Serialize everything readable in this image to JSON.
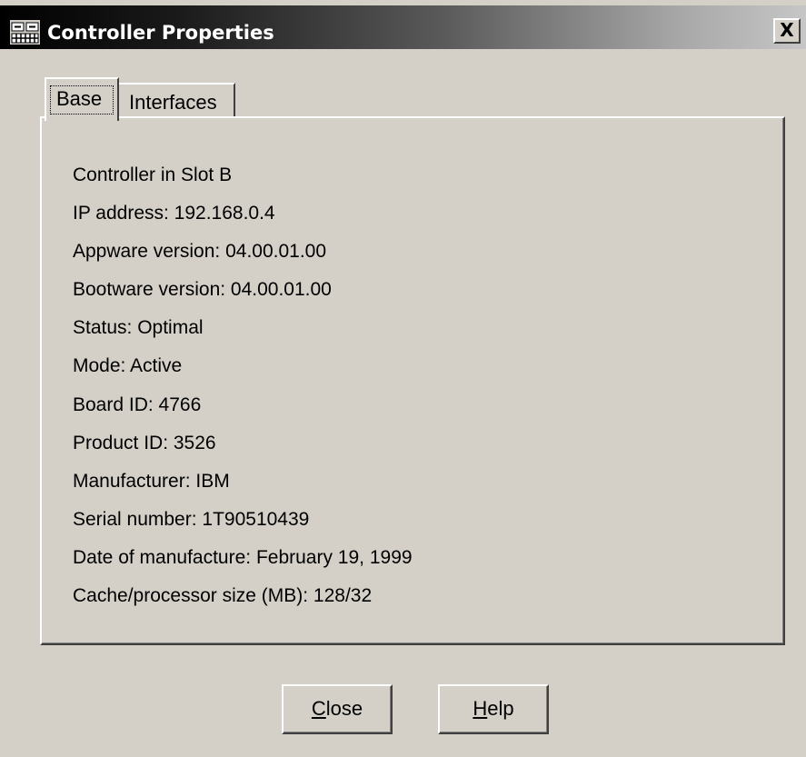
{
  "window": {
    "title": "Controller Properties",
    "close_glyph": "X",
    "icon": "controller-grid-icon"
  },
  "tabs": [
    {
      "label": "Base",
      "selected": true
    },
    {
      "label": "Interfaces",
      "selected": false
    }
  ],
  "properties": [
    "Controller in Slot B",
    "IP address: 192.168.0.4",
    "Appware version: 04.00.01.00",
    "Bootware version: 04.00.01.00",
    "Status: Optimal",
    "Mode: Active",
    "Board ID: 4766",
    "Product ID: 3526",
    "Manufacturer: IBM",
    "Serial number: 1T90510439",
    "Date of manufacture: February 19, 1999",
    "Cache/processor size (MB): 128/32"
  ],
  "buttons": {
    "close": {
      "mnemonic": "C",
      "rest": "lose"
    },
    "help": {
      "mnemonic": "H",
      "rest": "elp"
    }
  },
  "colors": {
    "face": "#d4d0c8",
    "title_start": "#000000",
    "title_end": "#c6c6c6"
  }
}
